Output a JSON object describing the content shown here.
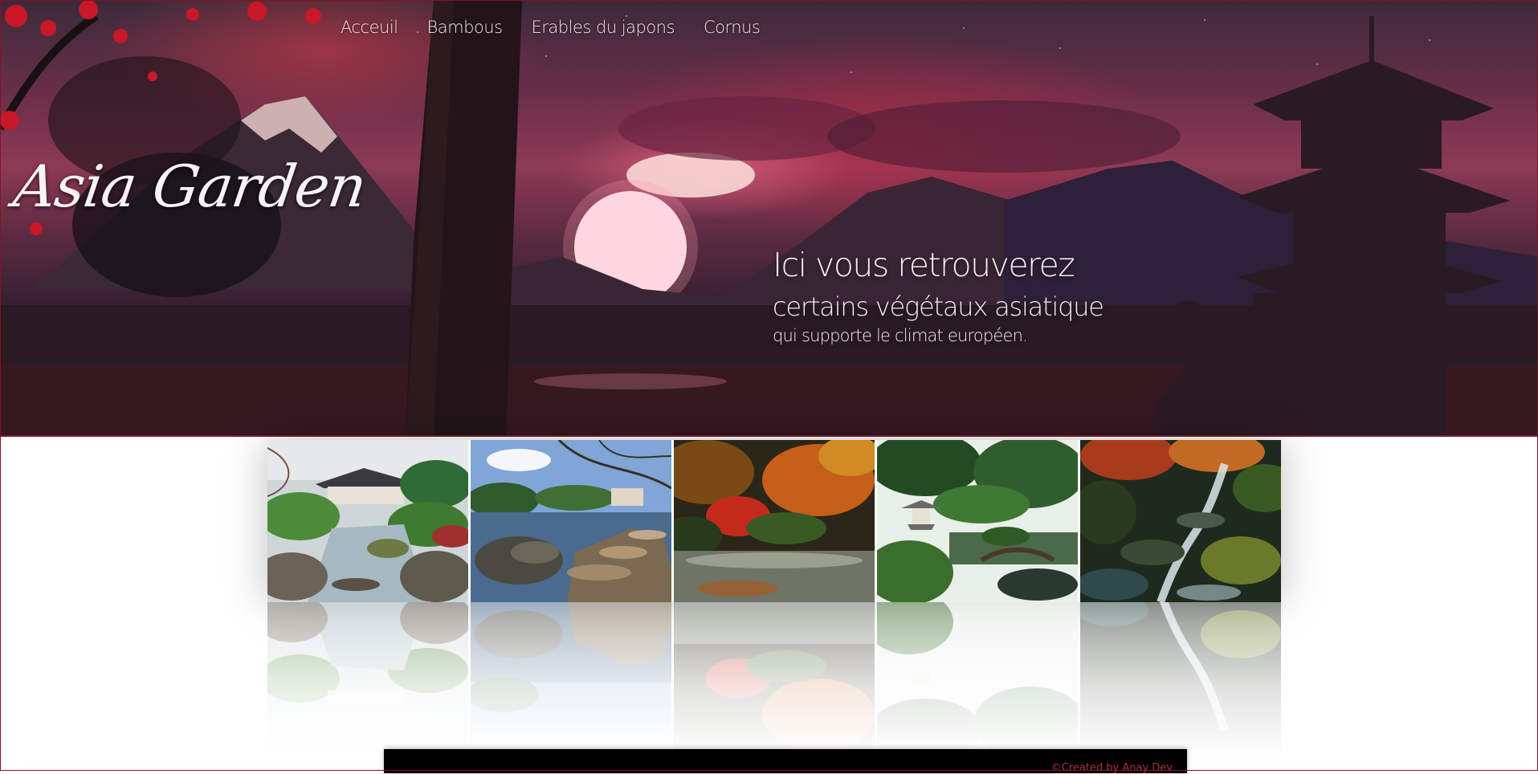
{
  "nav": {
    "items": [
      {
        "label": "Acceuil"
      },
      {
        "label": "Bambous"
      },
      {
        "label": "Erables du japons"
      },
      {
        "label": "Cornus"
      }
    ]
  },
  "hero": {
    "logo": "Asia Garden",
    "tagline": {
      "line1": "Ici vous retrouverez",
      "line2": "certains végétaux asiatique",
      "line3": "qui supporte  le climat  européen."
    }
  },
  "gallery": {
    "tiles": [
      {
        "scene": "garden-pond-house"
      },
      {
        "scene": "stepping-stones-pond"
      },
      {
        "scene": "autumn-maples-pond"
      },
      {
        "scene": "pagoda-lantern-garden"
      },
      {
        "scene": "waterfall-stream"
      }
    ]
  },
  "footer": {
    "credit": "©Created by Anay Dev"
  },
  "colors": {
    "accent": "#8a1020",
    "footer_bg": "#000000",
    "credit_text": "#b03040"
  }
}
